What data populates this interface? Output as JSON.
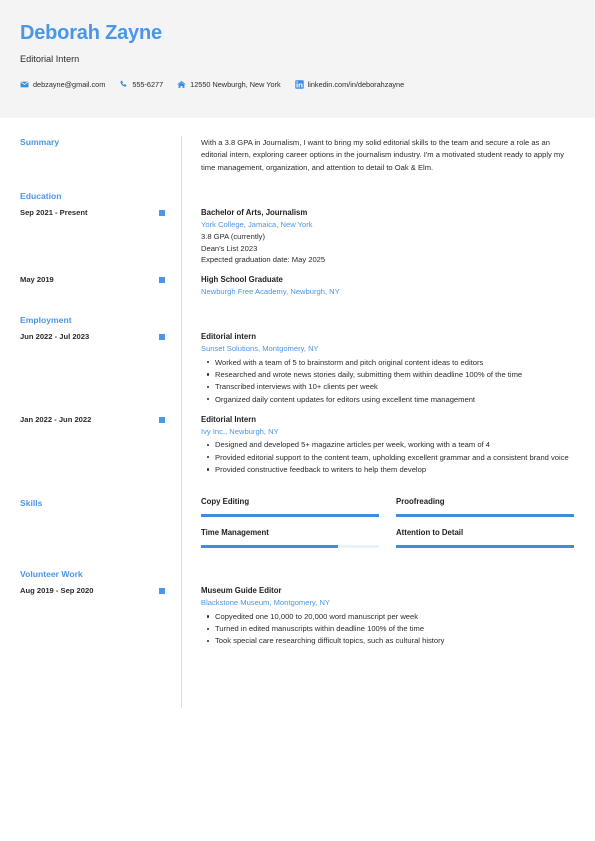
{
  "theme": {
    "accent": "#4a96e8",
    "accent_bar": "#3d8ce0",
    "header_bg": "#f4f4f4",
    "text": "#2b2b2b",
    "divider": "#dcdcdc"
  },
  "header": {
    "name": "Deborah Zayne",
    "job_title": "Editorial Intern",
    "contacts": [
      {
        "icon": "email-icon",
        "value": "debzayne@gmail.com"
      },
      {
        "icon": "phone-icon",
        "value": "555-6277"
      },
      {
        "icon": "home-icon",
        "value": "12550 Newburgh, New York"
      },
      {
        "icon": "linkedin-icon",
        "value": "linkedin.com/in/deborahzayne"
      }
    ]
  },
  "summary": {
    "title": "Summary",
    "text": "With a 3.8 GPA in Journalism, I want to bring my solid editorial skills to the team and secure a role as an editorial intern, exploring career options in the journalism industry. I'm a motivated student ready to apply my time management, organization, and attention to detail to Oak & Elm."
  },
  "education": {
    "title": "Education",
    "entries": [
      {
        "date": "Sep 2021 - Present",
        "role": "Bachelor of Arts, Journalism",
        "org": "York College, Jamaica, New York",
        "lines": [
          "3.8 GPA (currently)",
          "Dean's List 2023",
          "Expected graduation date: May 2025"
        ],
        "bullets": []
      },
      {
        "date": "May 2019",
        "role": "High School Graduate",
        "org": "Newburgh Free Academy, Newburgh, NY",
        "lines": [],
        "bullets": []
      }
    ]
  },
  "employment": {
    "title": "Employment",
    "entries": [
      {
        "date": "Jun 2022 - Jul 2023",
        "role": "Editorial intern",
        "org": "Sunset Solutions, Montgomery, NY",
        "lines": [],
        "bullets": [
          "Worked with a team of 5 to brainstorm and pitch original content ideas to editors",
          "Researched and wrote news stories daily, submitting them within deadline 100% of the time",
          "Transcribed interviews with 10+ clients per week",
          "Organized daily content updates for editors using excellent time management"
        ]
      },
      {
        "date": "Jan 2022 - Jun 2022",
        "role": "Editorial Intern",
        "org": "Ivy Inc., Newburgh, NY",
        "lines": [],
        "bullets": [
          "Designed and developed 5+ magazine articles per week, working with a team of 4",
          "Provided editorial support to the content team, upholding excellent grammar and a consistent brand voice",
          "Provided constructive feedback to writers to help them develop"
        ]
      }
    ]
  },
  "skills": {
    "title": "Skills",
    "items": [
      {
        "name": "Copy Editing",
        "level": 100
      },
      {
        "name": "Proofreading",
        "level": 100
      },
      {
        "name": "Time Management",
        "level": 77
      },
      {
        "name": "Attention to Detail",
        "level": 100
      }
    ]
  },
  "volunteer": {
    "title": "Volunteer Work",
    "entries": [
      {
        "date": "Aug 2019 - Sep 2020",
        "role": "Museum Guide Editor",
        "org": "Blackstone Museum, Montgomery, NY",
        "lines": [],
        "bullets": [
          "Copyedited one 10,000 to 20,000 word manuscript per week",
          "Turned in edited manuscripts within deadline 100% of the time",
          "Took special care researching difficult topics, such as cultural history"
        ]
      }
    ]
  }
}
